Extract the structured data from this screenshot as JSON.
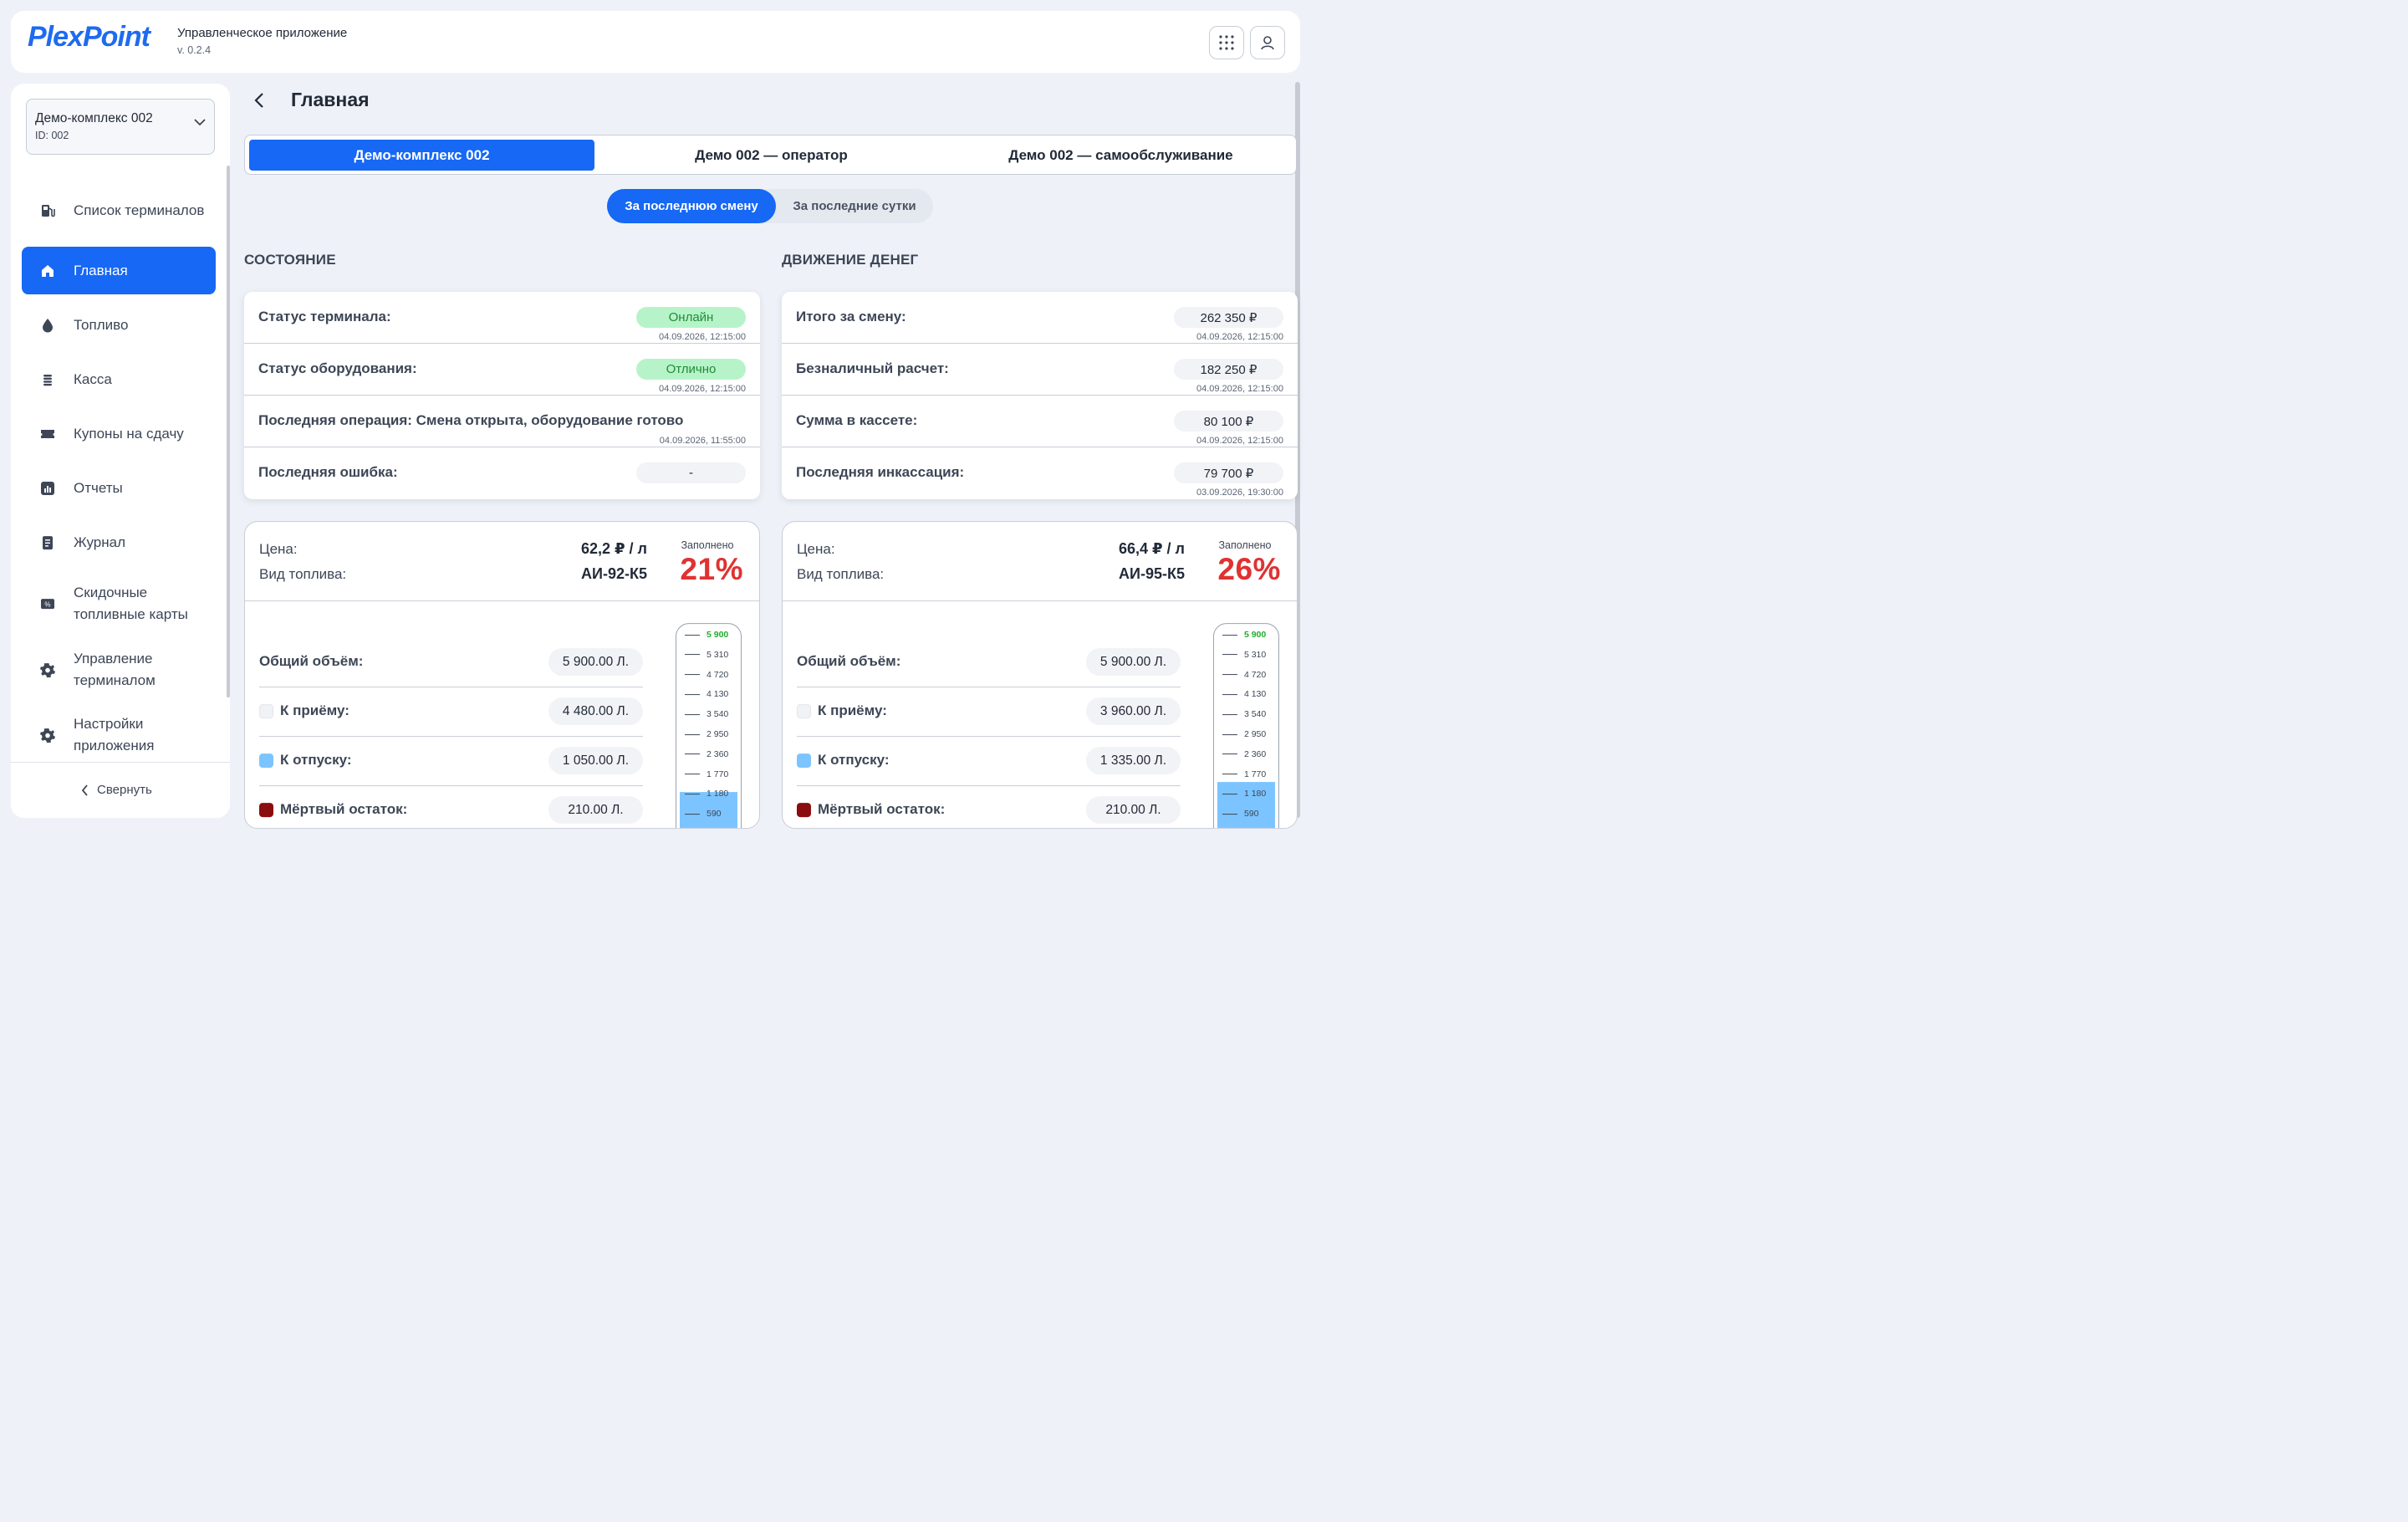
{
  "app": {
    "logo": "PlexPoint",
    "name": "Управленческое приложение",
    "version": "v. 0.2.4"
  },
  "header_icons": {
    "apps": "grid-icon",
    "user": "user-icon"
  },
  "sidebar": {
    "complex_name": "Демо-комплекс 002",
    "complex_id": "ID: 002",
    "items": [
      {
        "label": "Список терминалов",
        "icon": "fuel-pump-icon",
        "active": false
      },
      {
        "label": "Главная",
        "icon": "home-icon",
        "active": true
      },
      {
        "label": "Топливо",
        "icon": "drop-icon",
        "active": false
      },
      {
        "label": "Касса",
        "icon": "coins-icon",
        "active": false
      },
      {
        "label": "Купоны на сдачу",
        "icon": "ticket-icon",
        "active": false
      },
      {
        "label": "Отчеты",
        "icon": "chart-icon",
        "active": false
      },
      {
        "label": "Журнал",
        "icon": "journal-icon",
        "active": false
      },
      {
        "label": "Скидочные топливные карты",
        "icon": "discount-card-icon",
        "active": false
      },
      {
        "label": "Управление терминалом",
        "icon": "gear-icon",
        "active": false
      },
      {
        "label": "Настройки приложения",
        "icon": "gear-icon",
        "active": false
      }
    ],
    "collapse_label": "Свернуть"
  },
  "page": {
    "title": "Главная"
  },
  "tabs": [
    "Демо-комплекс 002",
    "Демо 002 — оператор",
    "Демо 002 — самообслуживание"
  ],
  "period": {
    "options": [
      "За последнюю смену",
      "За последние сутки"
    ],
    "selected": 0
  },
  "state": {
    "title": "СОСТОЯНИЕ",
    "rows": [
      {
        "label": "Статус терминала:",
        "value": "Онлайн",
        "ts": "04.09.2026, 12:15:00"
      },
      {
        "label": "Статус оборудования:",
        "value": "Отлично",
        "ts": "04.09.2026, 12:15:00"
      },
      {
        "label": "Последняя операция: Смена открыта, оборудование готово",
        "ts": "04.09.2026, 11:55:00"
      },
      {
        "label": "Последняя ошибка:",
        "value": "-"
      }
    ]
  },
  "money": {
    "title": "ДВИЖЕНИЕ ДЕНЕГ",
    "rows": [
      {
        "label": "Итого за смену:",
        "value": "262 350 ₽",
        "ts": "04.09.2026, 12:15:00"
      },
      {
        "label": "Безналичный расчет:",
        "value": "182 250 ₽",
        "ts": "04.09.2026, 12:15:00"
      },
      {
        "label": "Сумма в кассете:",
        "value": "80 100 ₽",
        "ts": "04.09.2026, 12:15:00"
      },
      {
        "label": "Последняя инкассация:",
        "value": "79 700 ₽",
        "ts": "03.09.2026, 19:30:00"
      }
    ]
  },
  "tank_labels": {
    "price": "Цена:",
    "fuel_type": "Вид топлива:",
    "filled": "Заполнено",
    "total": "Общий объём:",
    "to_receive": "К приёму:",
    "to_dispense": "К отпуску:",
    "dead": "Мёртвый остаток:"
  },
  "tanks": [
    {
      "price": "62,2 ₽ / л",
      "fuel": "АИ-92-К5",
      "filled_pct": "21%",
      "fill_fraction": 0.21,
      "total": "5 900.00 Л.",
      "to_receive": "4 480.00 Л.",
      "to_dispense": "1 050.00 Л.",
      "dead": "210.00 Л."
    },
    {
      "price": "66,4 ₽ / л",
      "fuel": "АИ-95-К5",
      "filled_pct": "26%",
      "fill_fraction": 0.26,
      "total": "5 900.00 Л.",
      "to_receive": "3 960.00 Л.",
      "to_dispense": "1 335.00 Л.",
      "dead": "210.00 Л."
    }
  ],
  "gauge_ticks": [
    "5 900",
    "5 310",
    "4 720",
    "4 130",
    "3 540",
    "2 950",
    "2 360",
    "1 770",
    "1 180",
    "590"
  ],
  "colors": {
    "accent": "#1668f5",
    "online": "#b7f3c9",
    "percent": "#e03232",
    "to_receive": "#f0f2f5",
    "to_dispense": "#7cc4ff",
    "dead": "#8b0c0c",
    "gauge_max": "#1fae2a"
  }
}
